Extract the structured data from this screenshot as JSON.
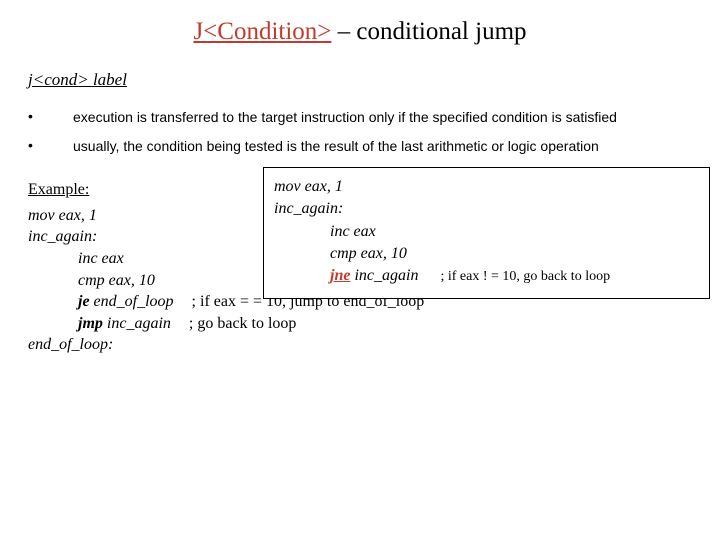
{
  "title": {
    "before": "J<Condition>",
    "after": " – conditional jump"
  },
  "syntax": "j<cond> label",
  "bullets": [
    "execution is transferred to the target instruction only if the specified condition is satisfied",
    "usually, the condition being tested is the result of the last arithmetic or logic operation"
  ],
  "example_label": "Example:",
  "left_code": {
    "l1": "mov eax, 1",
    "l2": "inc_again:",
    "l3": "inc eax",
    "l4": "cmp eax, 10",
    "je": {
      "kw": "je",
      "arg": " end_of_loop",
      "cmt": "; if eax = = 10, jump to end_of_loop"
    },
    "jmp": {
      "kw": "jmp",
      "arg": " inc_again",
      "cmt": "; go back to loop"
    },
    "l5": "end_of_loop:"
  },
  "box_code": {
    "b1": "mov eax, 1",
    "b2": "inc_again:",
    "b3": "inc eax",
    "b4": "cmp eax, 10",
    "jne": {
      "kw": "jne",
      "arg": " inc_again",
      "cmt": "; if eax ! = 10, go back to loop"
    }
  }
}
